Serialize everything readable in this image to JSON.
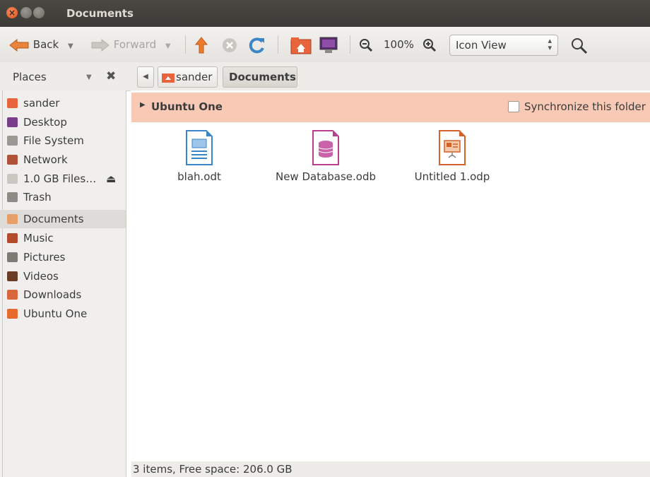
{
  "window": {
    "title": "Documents"
  },
  "toolbar": {
    "back_label": "Back",
    "forward_label": "Forward",
    "zoom_level": "100%",
    "view_mode": "Icon View"
  },
  "sidebar": {
    "header": "Places",
    "items": [
      {
        "label": "sander",
        "icon": "home-folder-icon",
        "color": "#e8643c"
      },
      {
        "label": "Desktop",
        "icon": "desktop-icon",
        "color": "#7a3d8c"
      },
      {
        "label": "File System",
        "icon": "harddisk-icon",
        "color": "#9a9892"
      },
      {
        "label": "Network",
        "icon": "network-icon",
        "color": "#b0523a"
      },
      {
        "label": "1.0 GB Files…",
        "icon": "usb-drive-icon",
        "color": "#c9c7c2"
      },
      {
        "label": "Trash",
        "icon": "trash-icon",
        "color": "#8d8b86"
      },
      {
        "label": "Documents",
        "icon": "documents-folder-icon",
        "color": "#e8a06a"
      },
      {
        "label": "Music",
        "icon": "music-folder-icon",
        "color": "#b34a2c"
      },
      {
        "label": "Pictures",
        "icon": "pictures-folder-icon",
        "color": "#7d7b76"
      },
      {
        "label": "Videos",
        "icon": "videos-folder-icon",
        "color": "#6b3c24"
      },
      {
        "label": "Downloads",
        "icon": "downloads-folder-icon",
        "color": "#d8673b"
      },
      {
        "label": "Ubuntu One",
        "icon": "ubuntu-one-folder-icon",
        "color": "#e66a2c"
      }
    ]
  },
  "pathbar": {
    "crumbs": [
      "sander",
      "Documents"
    ]
  },
  "ubuntu_one": {
    "label": "Ubuntu One",
    "sync_label": "Synchronize this folder"
  },
  "files": [
    {
      "name": "blah.odt",
      "icon": "writer-document-icon",
      "color": "#3a86c8"
    },
    {
      "name": "New Database.odb",
      "icon": "base-database-icon",
      "color": "#b9408f"
    },
    {
      "name": "Untitled 1.odp",
      "icon": "impress-presentation-icon",
      "color": "#d2622a"
    }
  ],
  "status": {
    "text": "3 items, Free space: 206.0 GB"
  }
}
